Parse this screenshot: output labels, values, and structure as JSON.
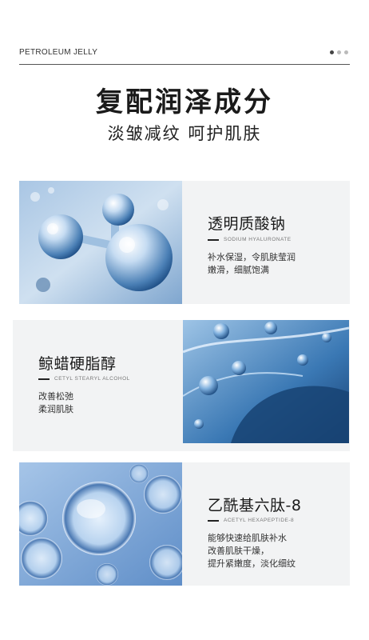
{
  "header": {
    "brand": "PETROLEUM JELLY",
    "title": "复配润泽成分",
    "subtitle": "淡皱减纹   呵护肌肤"
  },
  "sections": [
    {
      "name": "透明质酸钠",
      "en": "SODIUM HYALURONATE",
      "desc": [
        "补水保湿，令肌肤莹润",
        "嫩滑，细腻饱满"
      ]
    },
    {
      "name": "鲸蜡硬脂醇",
      "en": "CETYL STEARYL ALCOHOL",
      "desc": [
        "改善松弛",
        "柔润肌肤"
      ]
    },
    {
      "name": "乙酰基六肽-8",
      "en": "ACETYL HEXAPEPTIDE-8",
      "desc": [
        "能够快速给肌肤补水",
        "改善肌肤干燥，",
        "提升紧嫩度，淡化细纹"
      ]
    }
  ],
  "colors": {
    "card_bg": "#f2f3f4",
    "image_blue_light": "#bcd6ee",
    "image_blue_dark": "#1d4a7a"
  }
}
